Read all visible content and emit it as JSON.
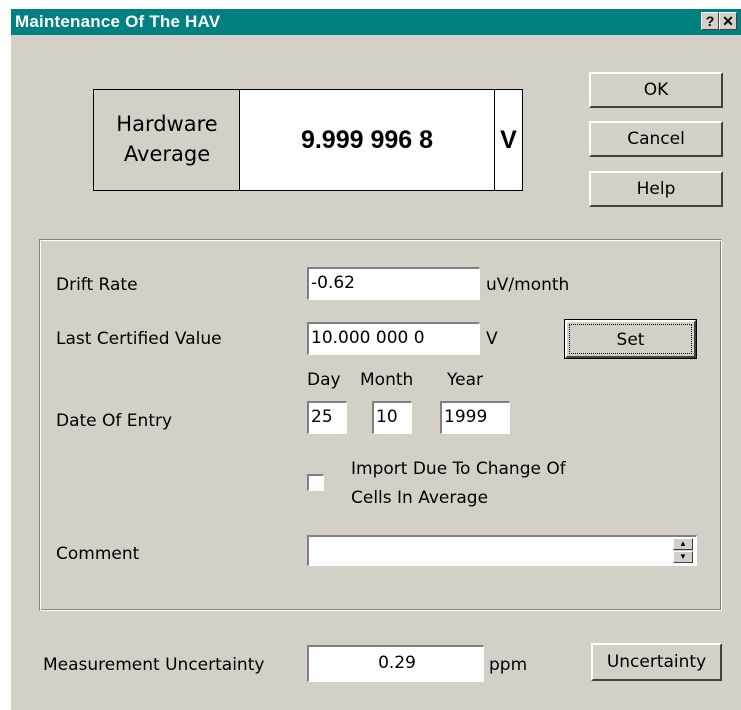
{
  "window": {
    "title": "Maintenance Of The HAV",
    "help_glyph": "?",
    "close_glyph": "✕"
  },
  "hav": {
    "label_line1": "Hardware",
    "label_line2": "Average",
    "value": "9.999 996 8",
    "unit": "V"
  },
  "buttons": {
    "ok": "OK",
    "cancel": "Cancel",
    "help": "Help",
    "set": "Set",
    "uncertainty": "Uncertainty"
  },
  "form": {
    "drift_rate": {
      "label": "Drift Rate",
      "value": "-0.62",
      "unit": "uV/month"
    },
    "last_certified": {
      "label": "Last Certified Value",
      "value": "10.000 000 0",
      "unit": "V"
    },
    "date": {
      "label": "Date Of Entry",
      "day_label": "Day",
      "month_label": "Month",
      "year_label": "Year",
      "day": "25",
      "month": "10",
      "year": "1999"
    },
    "import_checkbox": {
      "line1": "Import Due To Change Of",
      "line2": "Cells In Average",
      "checked": false
    },
    "comment": {
      "label": "Comment",
      "value": ""
    }
  },
  "uncertainty": {
    "label": "Measurement Uncertainty",
    "value": "0.29",
    "unit": "ppm"
  },
  "colors": {
    "titlebar": "#008080",
    "face": "#d4d0c8"
  }
}
